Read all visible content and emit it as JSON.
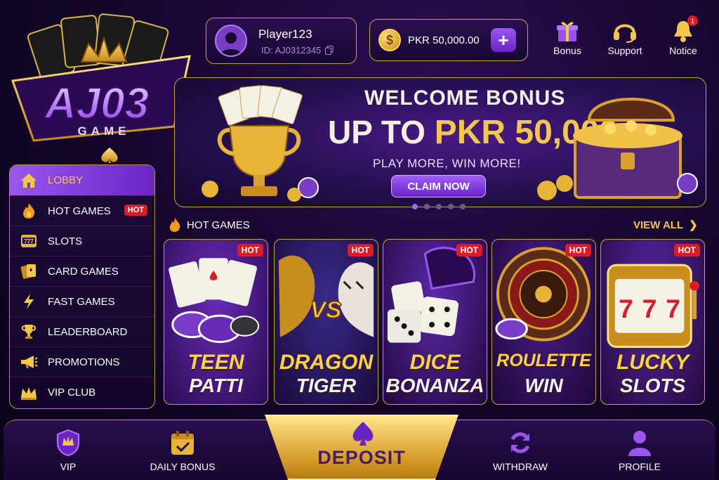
{
  "logo": {
    "text": "AJ03",
    "sub": "GAME"
  },
  "user": {
    "name": "Player123",
    "id": "ID: AJ0312345"
  },
  "wallet": {
    "balance": "PKR 50,000.00",
    "add_label": "+"
  },
  "top_actions": [
    {
      "label": "Bonus",
      "icon": "gift-icon"
    },
    {
      "label": "Support",
      "icon": "headset-icon"
    },
    {
      "label": "Notice",
      "icon": "bell-icon",
      "badge": "1"
    }
  ],
  "banner": {
    "title": "WELCOME BONUS",
    "amount_prefix": "UP TO ",
    "amount_currency": "PKR ",
    "amount_value": "50,000",
    "subtitle": "PLAY MORE, WIN MORE!",
    "cta": "CLAIM NOW",
    "slides": 5,
    "active_slide": 1
  },
  "sidebar": {
    "items": [
      {
        "label": "LOBBY",
        "icon": "home-icon",
        "active": true
      },
      {
        "label": "HOT GAMES",
        "icon": "fire-icon",
        "badge": "HOT"
      },
      {
        "label": "SLOTS",
        "icon": "slot-machine-icon"
      },
      {
        "label": "CARD GAMES",
        "icon": "cards-icon"
      },
      {
        "label": "FAST GAMES",
        "icon": "lightning-icon"
      },
      {
        "label": "LEADERBOARD",
        "icon": "trophy-icon"
      },
      {
        "label": "PROMOTIONS",
        "icon": "megaphone-icon"
      },
      {
        "label": "VIP CLUB",
        "icon": "crown-icon"
      }
    ]
  },
  "hot_games": {
    "title": "HOT GAMES",
    "view_all": "VIEW ALL",
    "games": [
      {
        "line1": "TEEN",
        "line2": "PATTI",
        "badge": "HOT"
      },
      {
        "line1": "DRAGON",
        "line2": "TIGER",
        "badge": "HOT"
      },
      {
        "line1": "DICE",
        "line2": "BONANZA",
        "badge": "HOT"
      },
      {
        "line1": "ROULETTE",
        "line2": "WIN",
        "badge": "HOT"
      },
      {
        "line1": "LUCKY",
        "line2": "SLOTS",
        "badge": "HOT"
      }
    ]
  },
  "bottom_nav": {
    "vip": "VIP",
    "daily_bonus": "DAILY BONUS",
    "deposit": "DEPOSIT",
    "withdraw": "WITHDRAW",
    "profile": "PROFILE"
  },
  "colors": {
    "accent_purple": "#8a45e6",
    "gold": "#f3c84a",
    "hot_red": "#d81d2a",
    "background": "#14062a"
  }
}
